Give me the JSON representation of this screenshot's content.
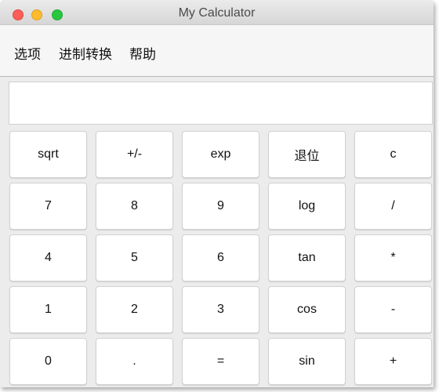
{
  "window": {
    "title": "My Calculator"
  },
  "menu": {
    "items": [
      "选项",
      "进制转换",
      "帮助"
    ]
  },
  "display": {
    "value": ""
  },
  "keypad": {
    "rows": [
      [
        "sqrt",
        "+/-",
        "exp",
        "退位",
        "c"
      ],
      [
        "7",
        "8",
        "9",
        "log",
        "/"
      ],
      [
        "4",
        "5",
        "6",
        "tan",
        "*"
      ],
      [
        "1",
        "2",
        "3",
        "cos",
        "-"
      ],
      [
        "0",
        ".",
        "=",
        "sin",
        "+"
      ]
    ]
  },
  "colors": {
    "close": "#fc5f57",
    "minimize": "#fdbb2d",
    "zoom": "#27c840"
  }
}
